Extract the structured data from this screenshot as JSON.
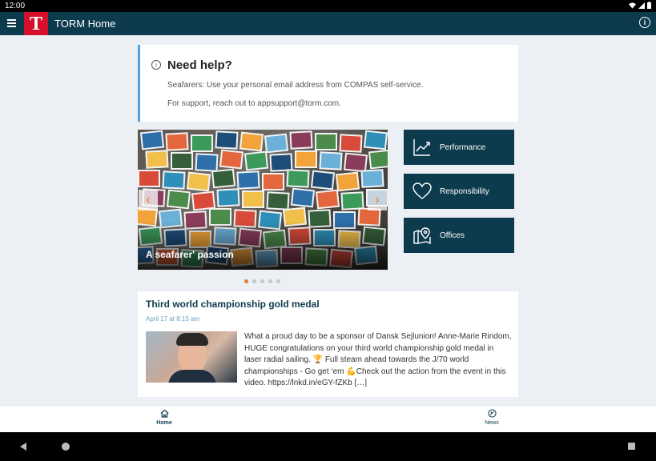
{
  "status_bar": {
    "time": "12:00"
  },
  "app_bar": {
    "logo_letter": "T",
    "title": "TORM Home",
    "brand_color": "#d6102a",
    "primary_color": "#0d3b4e"
  },
  "help": {
    "title": "Need help?",
    "line1": "Seafarers: Use your personal email address from COMPAS self-service.",
    "line2": "For support, reach out to appsupport@torm.com."
  },
  "carousel": {
    "caption": "A seafarer' passion",
    "prev_label": "‹",
    "next_label": "›",
    "slide_count": 5,
    "active_index": 0
  },
  "tiles": [
    {
      "label": "Performance",
      "icon": "chart-line-icon"
    },
    {
      "label": "Responsibility",
      "icon": "heart-icon"
    },
    {
      "label": "Offices",
      "icon": "map-pin-icon"
    }
  ],
  "news": {
    "title": "Third world championship gold medal",
    "date": "April 17 at 8:15 am",
    "body": "What a proud day to be a sponsor of Dansk Sejlunion! Anne-Marie Rindom, HUGE congratulations on your third world championship gold medal in laser radial sailing. 🏆 Full steam ahead towards the J/70 world championships - Go get ‘em 💪Check out the action from the event in this video. https://lnkd.in/eGY-fZKb […]"
  },
  "bottom_nav": [
    {
      "label": "Home",
      "icon": "home-icon"
    },
    {
      "label": "News",
      "icon": "news-icon"
    }
  ]
}
